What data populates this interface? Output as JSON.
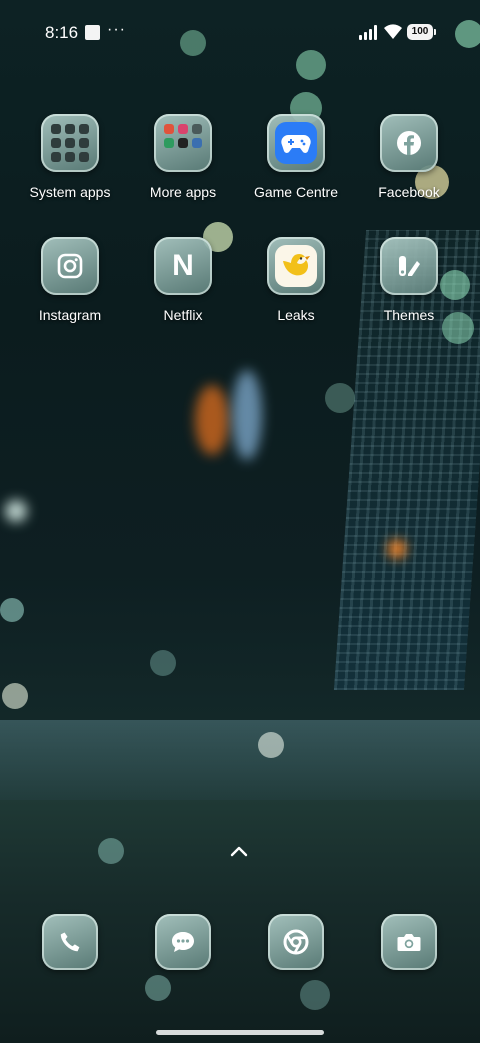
{
  "status_bar": {
    "time": "8:16",
    "more_indicator": "···",
    "battery": "100",
    "signal_icon": "cellular-signal-icon",
    "wifi_icon": "wifi-icon"
  },
  "home_grid": [
    {
      "label": "System apps",
      "icon": "folder-icon"
    },
    {
      "label": "More apps",
      "icon": "folder-icon"
    },
    {
      "label": "Game Centre",
      "icon": "gamepad-icon",
      "accent": "#2b7cf6"
    },
    {
      "label": "Facebook",
      "icon": "facebook-icon"
    },
    {
      "label": "Instagram",
      "icon": "instagram-icon"
    },
    {
      "label": "Netflix",
      "icon": "netflix-icon",
      "glyph": "N"
    },
    {
      "label": "Leaks",
      "icon": "bird-icon",
      "accent": "#f2c019"
    },
    {
      "label": "Themes",
      "icon": "themes-icon"
    }
  ],
  "swipe_hint_icon": "chevron-up-icon",
  "dock": [
    {
      "app": "Phone",
      "icon": "phone-icon"
    },
    {
      "app": "Messages",
      "icon": "message-icon"
    },
    {
      "app": "Chrome",
      "icon": "chrome-icon"
    },
    {
      "app": "Camera",
      "icon": "camera-icon"
    }
  ],
  "colors": {
    "icon_tile": "#7fa39e",
    "icon_glyph": "#ffffff",
    "wallpaper_dark": "#0c1a1c"
  }
}
